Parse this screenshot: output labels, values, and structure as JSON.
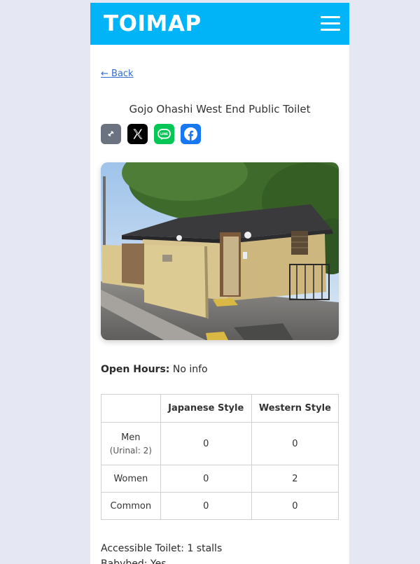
{
  "header": {
    "logo": "TOIMAP",
    "menu_icon": "hamburger-menu-icon"
  },
  "nav": {
    "back_label": "← Back"
  },
  "place": {
    "title": "Gojo Ohashi West End Public Toilet"
  },
  "share": {
    "buttons": [
      {
        "icon": "link-icon",
        "color": "#6b7280"
      },
      {
        "icon": "x-logo-icon",
        "color": "#000000"
      },
      {
        "icon": "line-logo-icon",
        "label": "LINE",
        "color": "#06c755"
      },
      {
        "icon": "facebook-logo-icon",
        "color": "#1877f2"
      }
    ]
  },
  "info": {
    "hours_label": "Open Hours:",
    "hours_value": "No info",
    "accessible": "Accessible Toilet: 1 stalls",
    "babybed": "Babybed: Yes"
  },
  "counts": {
    "headers": [
      "",
      "Japanese Style",
      "Western Style"
    ],
    "rows": [
      {
        "label": "Men",
        "note": "(Urinal: 2)",
        "japanese": "0",
        "western": "0"
      },
      {
        "label": "Women",
        "note": "",
        "japanese": "0",
        "western": "2"
      },
      {
        "label": "Common",
        "note": "",
        "japanese": "0",
        "western": "0"
      }
    ]
  },
  "colors": {
    "brand": "#00b4f7",
    "background": "#e5e7f2",
    "link": "#2f6fd1"
  }
}
